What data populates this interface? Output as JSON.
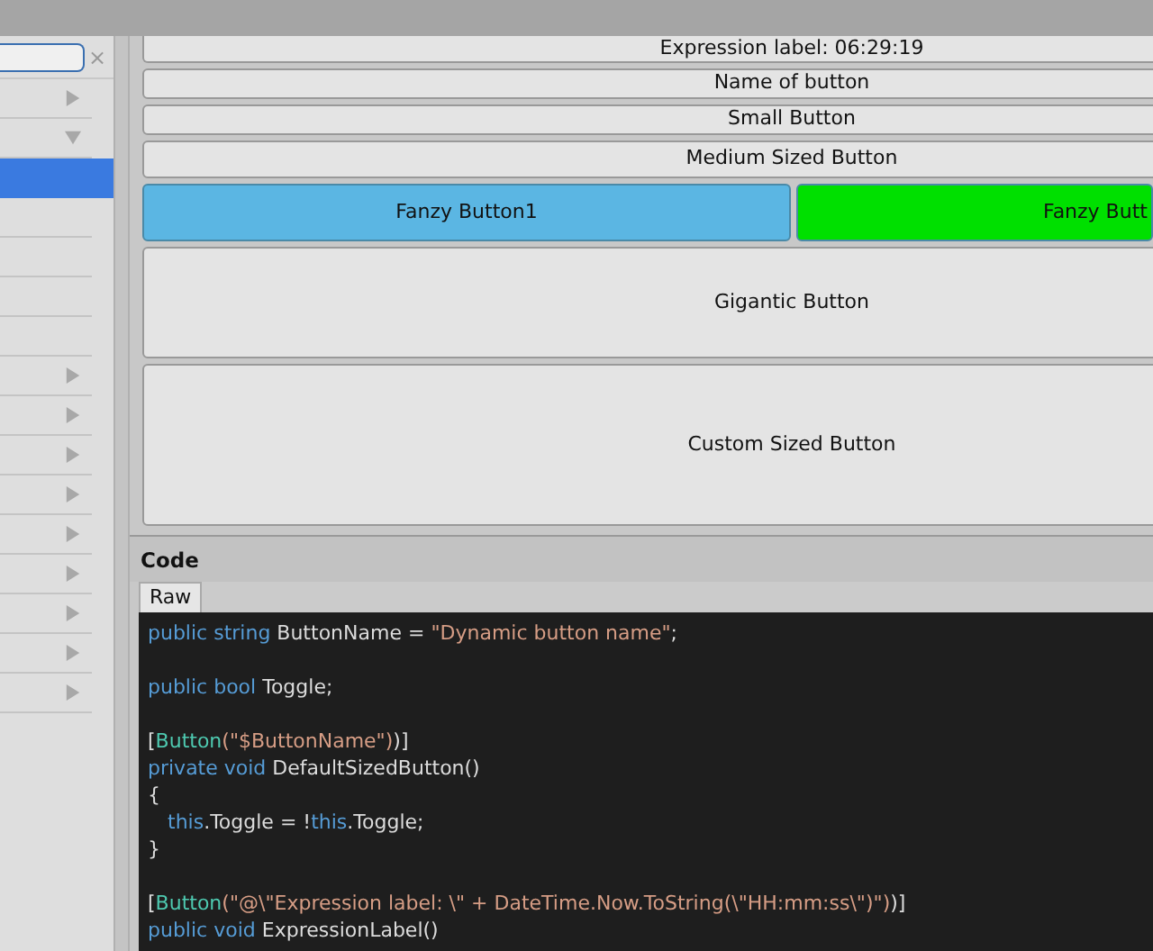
{
  "sidebar": {
    "search": {
      "clear": "×"
    },
    "items": [
      {
        "kind": "group",
        "expanded": false,
        "selected": false
      },
      {
        "kind": "group",
        "expanded": true,
        "selected": false
      },
      {
        "kind": "leaf",
        "selected": true
      },
      {
        "kind": "leaf",
        "selected": false
      },
      {
        "kind": "leaf",
        "selected": false
      },
      {
        "kind": "leaf",
        "selected": false
      },
      {
        "kind": "leaf",
        "selected": false
      },
      {
        "kind": "group",
        "expanded": false,
        "selected": false
      },
      {
        "kind": "group",
        "expanded": false,
        "selected": false
      },
      {
        "kind": "group",
        "expanded": false,
        "selected": false
      },
      {
        "kind": "group",
        "expanded": false,
        "selected": false
      },
      {
        "kind": "group",
        "expanded": false,
        "selected": false
      },
      {
        "kind": "group",
        "expanded": false,
        "selected": false
      },
      {
        "kind": "group",
        "expanded": false,
        "selected": false
      },
      {
        "kind": "group",
        "expanded": false,
        "selected": false
      },
      {
        "kind": "group",
        "expanded": false,
        "selected": false
      }
    ]
  },
  "preview": {
    "rows": [
      {
        "kind": "cut",
        "buttons": [
          {
            "label": "Expression label: 06:29:19"
          }
        ]
      },
      {
        "kind": "small",
        "buttons": [
          {
            "label": "Name of button"
          }
        ]
      },
      {
        "kind": "small",
        "buttons": [
          {
            "label": "Small Button"
          }
        ]
      },
      {
        "kind": "medium",
        "buttons": [
          {
            "label": "Medium Sized Button"
          }
        ]
      },
      {
        "kind": "large",
        "buttons": [
          {
            "label": "Fanzy Button1",
            "color": "#5bb6e3"
          },
          {
            "label": "Fanzy Butt",
            "color": "#00e000"
          }
        ]
      },
      {
        "kind": "gigantic",
        "buttons": [
          {
            "label": "Gigantic Button"
          }
        ]
      },
      {
        "kind": "custom",
        "buttons": [
          {
            "label": "Custom Sized Button"
          }
        ]
      }
    ]
  },
  "code": {
    "title": "Code",
    "tabs": [
      {
        "label": "Raw",
        "selected": true
      }
    ],
    "lines": [
      {
        "kind": "code",
        "tokens": [
          {
            "kind": "keyword",
            "text": "public string"
          },
          {
            "kind": "plain",
            "text": " ButtonName = "
          },
          {
            "kind": "string",
            "text": "\"Dynamic button name\""
          },
          {
            "kind": "plain",
            "text": ";"
          }
        ]
      },
      {
        "kind": "blank"
      },
      {
        "kind": "code",
        "tokens": [
          {
            "kind": "keyword",
            "text": "public bool"
          },
          {
            "kind": "plain",
            "text": " Toggle;"
          }
        ]
      },
      {
        "kind": "blank"
      },
      {
        "kind": "code",
        "tokens": [
          {
            "kind": "plain",
            "text": "["
          },
          {
            "kind": "type",
            "text": "Button"
          },
          {
            "kind": "string",
            "text": "(\"$ButtonName\")"
          },
          {
            "kind": "plain",
            "text": ")]"
          }
        ]
      },
      {
        "kind": "code",
        "tokens": [
          {
            "kind": "keyword",
            "text": "private void"
          },
          {
            "kind": "plain",
            "text": " DefaultSizedButton()"
          }
        ]
      },
      {
        "kind": "code",
        "tokens": [
          {
            "kind": "plain",
            "text": "{"
          }
        ]
      },
      {
        "kind": "indented",
        "tokens": [
          {
            "kind": "keyword",
            "text": "this"
          },
          {
            "kind": "plain",
            "text": ".Toggle = !"
          },
          {
            "kind": "keyword",
            "text": "this"
          },
          {
            "kind": "plain",
            "text": ".Toggle;"
          }
        ]
      },
      {
        "kind": "code",
        "tokens": [
          {
            "kind": "plain",
            "text": "}"
          }
        ]
      },
      {
        "kind": "blank"
      },
      {
        "kind": "code",
        "tokens": [
          {
            "kind": "plain",
            "text": "["
          },
          {
            "kind": "type",
            "text": "Button"
          },
          {
            "kind": "string",
            "text": "(\"@\\\"Expression label: \\\" + DateTime.Now.ToString(\\\"HH:mm:ss\\\")\")"
          },
          {
            "kind": "plain",
            "text": ")]"
          }
        ]
      },
      {
        "kind": "code",
        "tokens": [
          {
            "kind": "keyword",
            "text": "public void"
          },
          {
            "kind": "plain",
            "text": " ExpressionLabel()"
          }
        ]
      }
    ]
  }
}
